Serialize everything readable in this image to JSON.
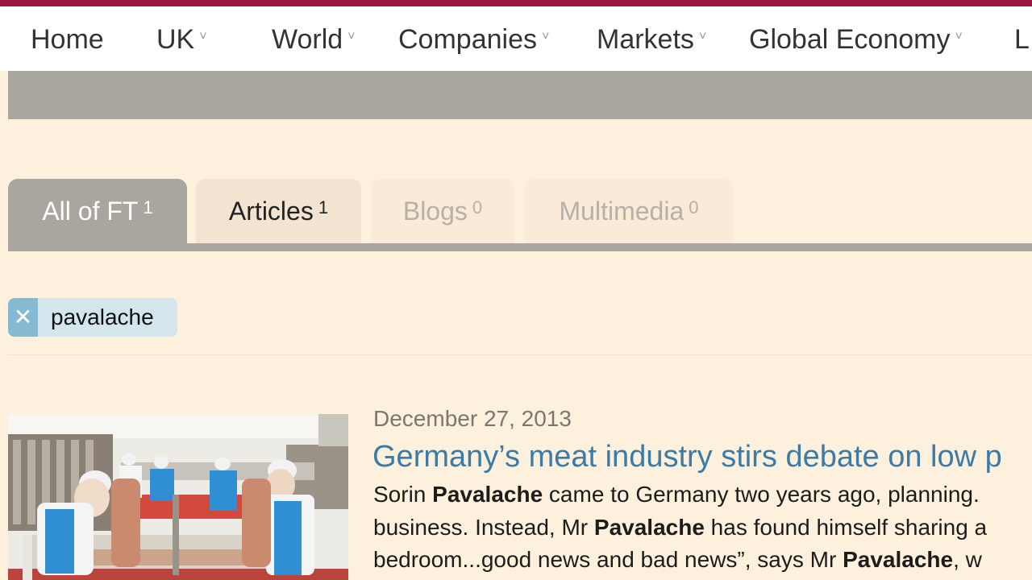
{
  "nav": {
    "items": [
      {
        "label": "Home",
        "has_dropdown": false
      },
      {
        "label": "UK",
        "has_dropdown": true
      },
      {
        "label": "World",
        "has_dropdown": true
      },
      {
        "label": "Companies",
        "has_dropdown": true
      },
      {
        "label": "Markets",
        "has_dropdown": true
      },
      {
        "label": "Global Economy",
        "has_dropdown": true
      },
      {
        "label": "L",
        "has_dropdown": false
      }
    ],
    "chevron": "˅"
  },
  "tabs": [
    {
      "label": "All of FT",
      "count": "1",
      "active": true
    },
    {
      "label": "Articles",
      "count": "1",
      "active": false
    },
    {
      "label": "Blogs",
      "count": "0",
      "active": false
    },
    {
      "label": "Multimedia",
      "count": "0",
      "active": false
    }
  ],
  "search_filter": {
    "term": "pavalache",
    "remove_icon": "close-icon",
    "remove_glyph": "✕"
  },
  "results": [
    {
      "date": "December 27, 2013",
      "headline": "Germany’s meat industry stirs debate on low p",
      "snippet_lines": [
        [
          "Sorin ",
          "Pavalache",
          " came to Germany two years ago, planning."
        ],
        [
          "business. Instead, Mr ",
          "Pavalache",
          " has found himself sharing a"
        ],
        [
          "bedroom...good news and bad news”, says Mr ",
          "Pavalache",
          ", w"
        ]
      ]
    }
  ],
  "colors": {
    "brand_bar": "#9d1446",
    "page_bg": "#fdf1dd",
    "tab_active_bg": "#a9a69f",
    "link_blue": "#3c7aa7",
    "chip_bg": "#d4e6ec",
    "chip_x_bg": "#86bad2"
  }
}
